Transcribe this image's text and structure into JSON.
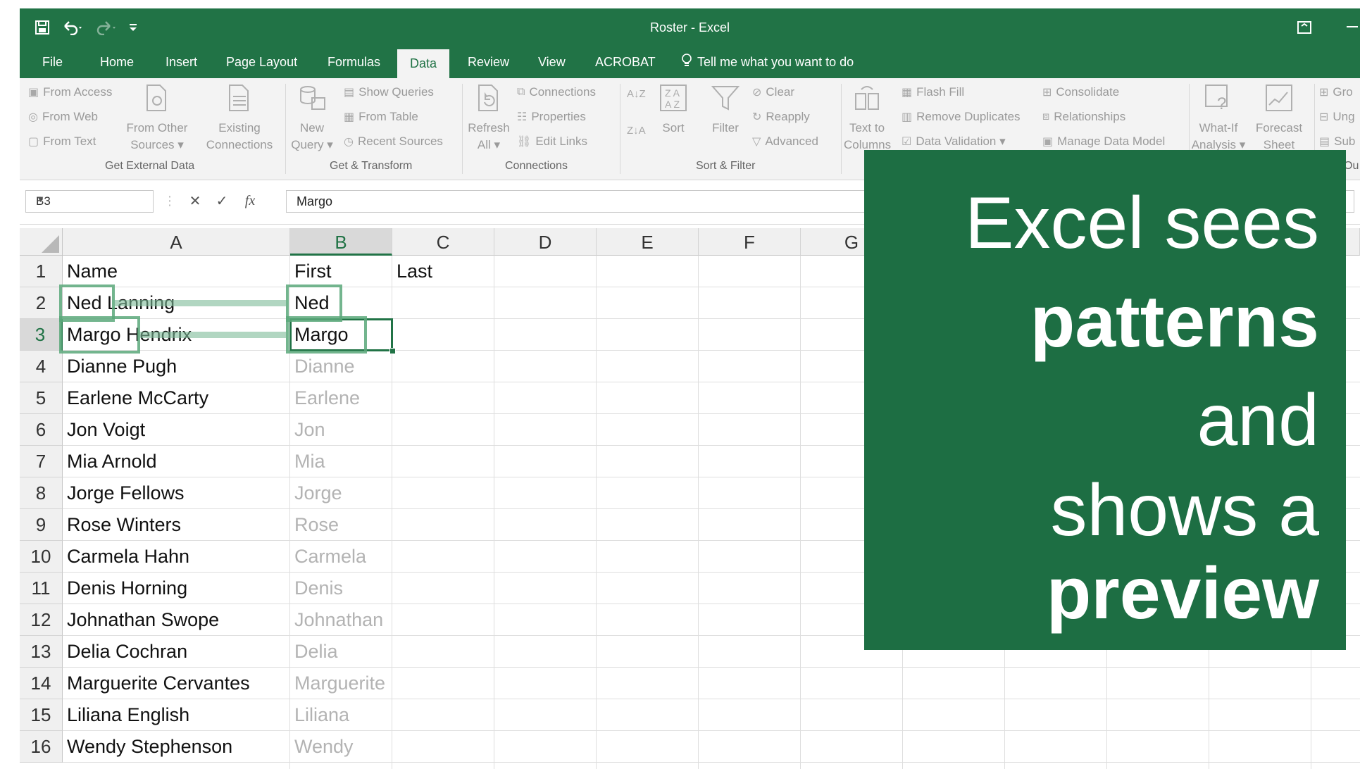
{
  "window": {
    "title": "Roster  -  Excel"
  },
  "tabs": [
    "File",
    "Home",
    "Insert",
    "Page Layout",
    "Formulas",
    "Data",
    "Review",
    "View",
    "ACROBAT"
  ],
  "active_tab": "Data",
  "tell_me": "Tell me what you want to do",
  "ribbon": {
    "get_external": {
      "from_access": "From Access",
      "from_web": "From Web",
      "from_text": "From Text",
      "from_other_1": "From Other",
      "from_other_2": "Sources ▾",
      "existing_1": "Existing",
      "existing_2": "Connections",
      "label": "Get External Data"
    },
    "get_transform": {
      "new_query_1": "New",
      "new_query_2": "Query ▾",
      "show_queries": "Show Queries",
      "from_table": "From Table",
      "recent_sources": "Recent Sources",
      "label": "Get & Transform"
    },
    "connections": {
      "refresh_1": "Refresh",
      "refresh_2": "All ▾",
      "connections": "Connections",
      "properties": "Properties",
      "edit_links": "Edit Links",
      "label": "Connections"
    },
    "sort_filter": {
      "sort": "Sort",
      "filter": "Filter",
      "clear": "Clear",
      "reapply": "Reapply",
      "advanced": "Advanced",
      "label": "Sort & Filter"
    },
    "data_tools": {
      "text_to_1": "Text to",
      "text_to_2": "Columns",
      "flash_fill": "Flash Fill",
      "remove_duplicates": "Remove Duplicates",
      "data_validation": "Data Validation  ▾",
      "consolidate": "Consolidate",
      "relationships": "Relationships",
      "manage_data_model": "Manage Data Model"
    },
    "forecast": {
      "what_if_1": "What-If",
      "what_if_2": "Analysis ▾",
      "forecast_1": "Forecast",
      "forecast_2": "Sheet"
    },
    "outline": {
      "group": "Gro",
      "ungroup": "Ung",
      "subtotal": "Sub",
      "label": "Ou"
    }
  },
  "formula_bar": {
    "name_box": "B3",
    "value": "Margo"
  },
  "columns": [
    "A",
    "B",
    "C",
    "D",
    "E",
    "F",
    "G"
  ],
  "rows": [
    {
      "num": "1",
      "a": "Name",
      "b": "First",
      "c": "Last",
      "b_preview": false
    },
    {
      "num": "2",
      "a": "Ned Lanning",
      "b": "Ned",
      "c": "",
      "b_preview": false
    },
    {
      "num": "3",
      "a": "Margo Hendrix",
      "b": "Margo",
      "c": "",
      "b_preview": false
    },
    {
      "num": "4",
      "a": "Dianne Pugh",
      "b": "Dianne",
      "c": "",
      "b_preview": true
    },
    {
      "num": "5",
      "a": "Earlene McCarty",
      "b": "Earlene",
      "c": "",
      "b_preview": true
    },
    {
      "num": "6",
      "a": "Jon Voigt",
      "b": "Jon",
      "c": "",
      "b_preview": true
    },
    {
      "num": "7",
      "a": "Mia Arnold",
      "b": "Mia",
      "c": "",
      "b_preview": true
    },
    {
      "num": "8",
      "a": "Jorge Fellows",
      "b": "Jorge",
      "c": "",
      "b_preview": true
    },
    {
      "num": "9",
      "a": "Rose Winters",
      "b": "Rose",
      "c": "",
      "b_preview": true
    },
    {
      "num": "10",
      "a": "Carmela Hahn",
      "b": "Carmela",
      "c": "",
      "b_preview": true
    },
    {
      "num": "11",
      "a": "Denis Horning",
      "b": "Denis",
      "c": "",
      "b_preview": true
    },
    {
      "num": "12",
      "a": "Johnathan Swope",
      "b": "Johnathan",
      "c": "",
      "b_preview": true
    },
    {
      "num": "13",
      "a": "Delia Cochran",
      "b": "Delia",
      "c": "",
      "b_preview": true
    },
    {
      "num": "14",
      "a": "Marguerite Cervantes",
      "b": "Marguerite",
      "c": "",
      "b_preview": true
    },
    {
      "num": "15",
      "a": "Liliana English",
      "b": "Liliana",
      "c": "",
      "b_preview": true
    },
    {
      "num": "16",
      "a": "Wendy Stephenson",
      "b": "Wendy",
      "c": "",
      "b_preview": true
    }
  ],
  "overlay": {
    "lines": [
      "Excel sees",
      "patterns",
      "and",
      "shows a",
      "preview"
    ]
  },
  "colors": {
    "excel_green": "#217346",
    "overlay_green": "#1d6e43",
    "preview_text": "#b3b3b3"
  }
}
